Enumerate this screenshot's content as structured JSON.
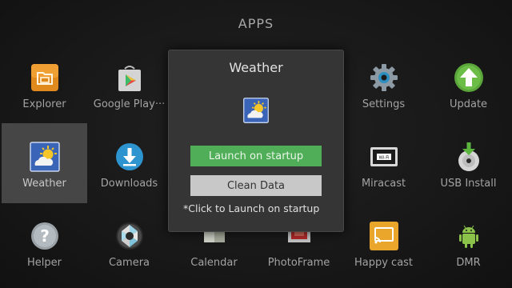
{
  "header": {
    "title": "APPS"
  },
  "apps": [
    {
      "label": "Explorer",
      "icon": "folder-icon"
    },
    {
      "label": "Google Play···",
      "icon": "play-store-icon"
    },
    {
      "label": "Settings",
      "icon": "gear-icon"
    },
    {
      "label": "Update",
      "icon": "up-arrow-icon"
    },
    {
      "label": "Weather",
      "icon": "weather-icon",
      "selected": true
    },
    {
      "label": "Downloads",
      "icon": "download-icon"
    },
    {
      "label": "Miracast",
      "icon": "miracast-icon"
    },
    {
      "label": "USB Install",
      "icon": "usb-install-icon"
    },
    {
      "label": "Helper",
      "icon": "help-icon"
    },
    {
      "label": "Camera",
      "icon": "camera-icon"
    },
    {
      "label": "Calendar",
      "icon": "calendar-icon"
    },
    {
      "label": "PhotoFrame",
      "icon": "photoframe-icon"
    },
    {
      "label": "Happy cast",
      "icon": "happy-cast-icon"
    },
    {
      "label": "DMR",
      "icon": "android-icon"
    }
  ],
  "dialog": {
    "title": "Weather",
    "icon": "weather-icon",
    "launch_button": "Launch on startup",
    "clean_button": "Clean Data",
    "note": "*Click to Launch on startup"
  },
  "colors": {
    "launch_button": "#4fae57",
    "clean_button": "#c8c8c8",
    "selected_tile": "#464646",
    "dialog_bg": "#353535"
  }
}
